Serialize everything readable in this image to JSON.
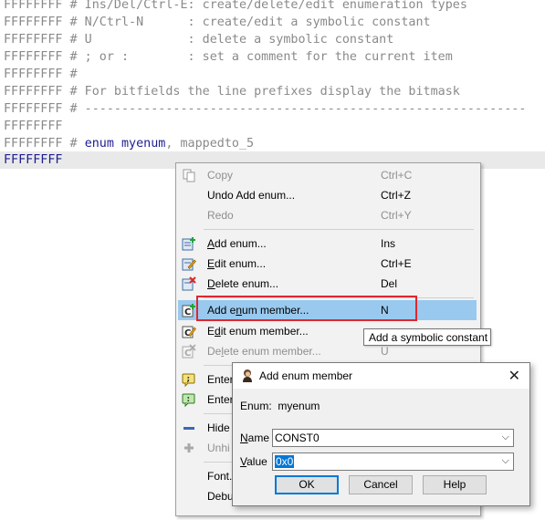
{
  "editor": {
    "lines": [
      {
        "addr": "FFFFFFFF",
        "text": " # Ins/Del/Ctrl-E: create/delete/edit enumeration types"
      },
      {
        "addr": "FFFFFFFF",
        "text": " # N/Ctrl-N      : create/edit a symbolic constant"
      },
      {
        "addr": "FFFFFFFF",
        "text": " # U             : delete a symbolic constant"
      },
      {
        "addr": "FFFFFFFF",
        "text": " # ; or :        : set a comment for the current item"
      },
      {
        "addr": "FFFFFFFF",
        "text": " #"
      },
      {
        "addr": "FFFFFFFF",
        "text": " # For bitfields the line prefixes display the bitmask"
      },
      {
        "addr": "FFFFFFFF",
        "text": " # ------------------------------------------------------------"
      },
      {
        "addr": "FFFFFFFF",
        "text": ""
      }
    ],
    "enum_line": {
      "addr": "FFFFFFFF",
      "hash": " # ",
      "kw": "enum",
      "name": "myenum",
      "rest": ", mappedto_5"
    },
    "current_line": {
      "addr": "FFFFFFFF"
    }
  },
  "menu": {
    "items": [
      {
        "label": "Copy",
        "shortcut": "Ctrl+C",
        "icon": "copy-icon"
      },
      {
        "label": "Undo Add enum...",
        "shortcut": "Ctrl+Z",
        "icon": ""
      },
      {
        "label": "Redo",
        "shortcut": "Ctrl+Y",
        "icon": ""
      },
      {
        "label": "Add enum...",
        "shortcut": "Ins",
        "icon": "add-enum-icon"
      },
      {
        "label": "Edit enum...",
        "shortcut": "Ctrl+E",
        "icon": "edit-enum-icon"
      },
      {
        "label": "Delete enum...",
        "shortcut": "Del",
        "icon": "delete-enum-icon"
      },
      {
        "label": "Add enum member...",
        "shortcut": "N",
        "icon": "add-member-icon"
      },
      {
        "label": "Edit enum member...",
        "shortcut": "",
        "icon": "edit-member-icon"
      },
      {
        "label": "Delete enum member...",
        "shortcut": "U",
        "icon": "delete-member-icon"
      },
      {
        "label": "Enter",
        "shortcut": "",
        "icon": "comment-icon"
      },
      {
        "label": "Enter",
        "shortcut": "",
        "icon": "repeatable-comment-icon"
      },
      {
        "label": "Hide",
        "shortcut": "",
        "icon": "hide-icon"
      },
      {
        "label": "Unhi",
        "shortcut": "",
        "icon": "unhide-icon"
      },
      {
        "label": "Font.",
        "shortcut": "",
        "icon": ""
      },
      {
        "label": "Debu",
        "shortcut": "",
        "icon": ""
      }
    ],
    "tooltip": "Add a symbolic constant"
  },
  "dialog": {
    "title": "Add enum member",
    "enum_label": "Enum:",
    "enum_value": "myenum",
    "name_label": "Name",
    "name_value": "CONST0",
    "value_label": "Value",
    "value_value": "0x0",
    "ok": "OK",
    "cancel": "Cancel",
    "help": "Help",
    "close": "✕"
  },
  "colors": {
    "highlight": "#99c9ef",
    "red_box": "#e0262e",
    "accent": "#0078d7"
  }
}
